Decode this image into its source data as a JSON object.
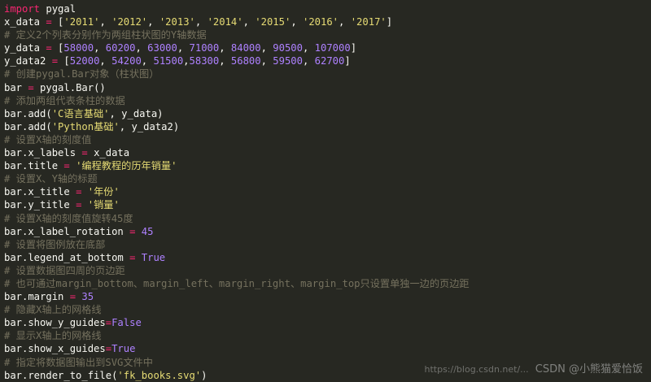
{
  "colors": {
    "background": "#272822",
    "plain": "#f8f8f2",
    "keyword": "#f92672",
    "string": "#e6db74",
    "number": "#ae81ff",
    "comment": "#75715e"
  },
  "code_lines": [
    [
      {
        "t": "import",
        "c": "kw"
      },
      {
        "t": " pygal",
        "c": "plain"
      }
    ],
    [
      {
        "t": "x_data ",
        "c": "plain"
      },
      {
        "t": "=",
        "c": "op"
      },
      {
        "t": " [",
        "c": "plain"
      },
      {
        "t": "'2011'",
        "c": "str"
      },
      {
        "t": ", ",
        "c": "plain"
      },
      {
        "t": "'2012'",
        "c": "str"
      },
      {
        "t": ", ",
        "c": "plain"
      },
      {
        "t": "'2013'",
        "c": "str"
      },
      {
        "t": ", ",
        "c": "plain"
      },
      {
        "t": "'2014'",
        "c": "str"
      },
      {
        "t": ", ",
        "c": "plain"
      },
      {
        "t": "'2015'",
        "c": "str"
      },
      {
        "t": ", ",
        "c": "plain"
      },
      {
        "t": "'2016'",
        "c": "str"
      },
      {
        "t": ", ",
        "c": "plain"
      },
      {
        "t": "'2017'",
        "c": "str"
      },
      {
        "t": "]",
        "c": "plain"
      }
    ],
    [
      {
        "t": "# 定义2个列表分别作为两组柱状图的Y轴数据",
        "c": "cmt"
      }
    ],
    [
      {
        "t": "y_data ",
        "c": "plain"
      },
      {
        "t": "=",
        "c": "op"
      },
      {
        "t": " [",
        "c": "plain"
      },
      {
        "t": "58000",
        "c": "num"
      },
      {
        "t": ", ",
        "c": "plain"
      },
      {
        "t": "60200",
        "c": "num"
      },
      {
        "t": ", ",
        "c": "plain"
      },
      {
        "t": "63000",
        "c": "num"
      },
      {
        "t": ", ",
        "c": "plain"
      },
      {
        "t": "71000",
        "c": "num"
      },
      {
        "t": ", ",
        "c": "plain"
      },
      {
        "t": "84000",
        "c": "num"
      },
      {
        "t": ", ",
        "c": "plain"
      },
      {
        "t": "90500",
        "c": "num"
      },
      {
        "t": ", ",
        "c": "plain"
      },
      {
        "t": "107000",
        "c": "num"
      },
      {
        "t": "]",
        "c": "plain"
      }
    ],
    [
      {
        "t": "y_data2 ",
        "c": "plain"
      },
      {
        "t": "=",
        "c": "op"
      },
      {
        "t": " [",
        "c": "plain"
      },
      {
        "t": "52000",
        "c": "num"
      },
      {
        "t": ", ",
        "c": "plain"
      },
      {
        "t": "54200",
        "c": "num"
      },
      {
        "t": ", ",
        "c": "plain"
      },
      {
        "t": "51500",
        "c": "num"
      },
      {
        "t": ",",
        "c": "plain"
      },
      {
        "t": "58300",
        "c": "num"
      },
      {
        "t": ", ",
        "c": "plain"
      },
      {
        "t": "56800",
        "c": "num"
      },
      {
        "t": ", ",
        "c": "plain"
      },
      {
        "t": "59500",
        "c": "num"
      },
      {
        "t": ", ",
        "c": "plain"
      },
      {
        "t": "62700",
        "c": "num"
      },
      {
        "t": "]",
        "c": "plain"
      }
    ],
    [
      {
        "t": "# 创建pygal.Bar对象（柱状图）",
        "c": "cmt"
      }
    ],
    [
      {
        "t": "bar ",
        "c": "plain"
      },
      {
        "t": "=",
        "c": "op"
      },
      {
        "t": " pygal.Bar()",
        "c": "plain"
      }
    ],
    [
      {
        "t": "# 添加两组代表条柱的数据",
        "c": "cmt"
      }
    ],
    [
      {
        "t": "bar.add(",
        "c": "plain"
      },
      {
        "t": "'C语言基础'",
        "c": "str"
      },
      {
        "t": ", y_data)",
        "c": "plain"
      }
    ],
    [
      {
        "t": "bar.add(",
        "c": "plain"
      },
      {
        "t": "'Python基础'",
        "c": "str"
      },
      {
        "t": ", y_data2)",
        "c": "plain"
      }
    ],
    [
      {
        "t": "# 设置X轴的刻度值",
        "c": "cmt"
      }
    ],
    [
      {
        "t": "bar.x_labels ",
        "c": "plain"
      },
      {
        "t": "=",
        "c": "op"
      },
      {
        "t": " x_data",
        "c": "plain"
      }
    ],
    [
      {
        "t": "bar.title ",
        "c": "plain"
      },
      {
        "t": "=",
        "c": "op"
      },
      {
        "t": " ",
        "c": "plain"
      },
      {
        "t": "'编程教程的历年销量'",
        "c": "str"
      }
    ],
    [
      {
        "t": "# 设置X、Y轴的标题",
        "c": "cmt"
      }
    ],
    [
      {
        "t": "bar.x_title ",
        "c": "plain"
      },
      {
        "t": "=",
        "c": "op"
      },
      {
        "t": " ",
        "c": "plain"
      },
      {
        "t": "'年份'",
        "c": "str"
      }
    ],
    [
      {
        "t": "bar.y_title ",
        "c": "plain"
      },
      {
        "t": "=",
        "c": "op"
      },
      {
        "t": " ",
        "c": "plain"
      },
      {
        "t": "'销量'",
        "c": "str"
      }
    ],
    [
      {
        "t": "# 设置X轴的刻度值旋转45度",
        "c": "cmt"
      }
    ],
    [
      {
        "t": "bar.x_label_rotation ",
        "c": "plain"
      },
      {
        "t": "=",
        "c": "op"
      },
      {
        "t": " ",
        "c": "plain"
      },
      {
        "t": "45",
        "c": "num"
      }
    ],
    [
      {
        "t": "# 设置将图例放在底部",
        "c": "cmt"
      }
    ],
    [
      {
        "t": "bar.legend_at_bottom ",
        "c": "plain"
      },
      {
        "t": "=",
        "c": "op"
      },
      {
        "t": " ",
        "c": "plain"
      },
      {
        "t": "True",
        "c": "const"
      }
    ],
    [
      {
        "t": "# 设置数据图四周的页边距",
        "c": "cmt"
      }
    ],
    [
      {
        "t": "# 也可通过margin_bottom、margin_left、margin_right、margin_top只设置单独一边的页边距",
        "c": "cmt"
      }
    ],
    [
      {
        "t": "bar.margin ",
        "c": "plain"
      },
      {
        "t": "=",
        "c": "op"
      },
      {
        "t": " ",
        "c": "plain"
      },
      {
        "t": "35",
        "c": "num"
      }
    ],
    [
      {
        "t": "# 隐藏X轴上的网格线",
        "c": "cmt"
      }
    ],
    [
      {
        "t": "bar.show_y_guides",
        "c": "plain"
      },
      {
        "t": "=",
        "c": "op"
      },
      {
        "t": "False",
        "c": "const"
      }
    ],
    [
      {
        "t": "# 显示X轴上的网格线",
        "c": "cmt"
      }
    ],
    [
      {
        "t": "bar.show_x_guides",
        "c": "plain"
      },
      {
        "t": "=",
        "c": "op"
      },
      {
        "t": "True",
        "c": "const"
      }
    ],
    [
      {
        "t": "# 指定将数据图输出到SVG文件中",
        "c": "cmt"
      }
    ],
    [
      {
        "t": "bar.render_to_file(",
        "c": "plain"
      },
      {
        "t": "'fk_books.svg'",
        "c": "str"
      },
      {
        "t": ")",
        "c": "plain"
      }
    ]
  ],
  "watermark": {
    "site": "https://blog.csdn.net/...",
    "text": "CSDN @小熊猫爱恰饭"
  }
}
